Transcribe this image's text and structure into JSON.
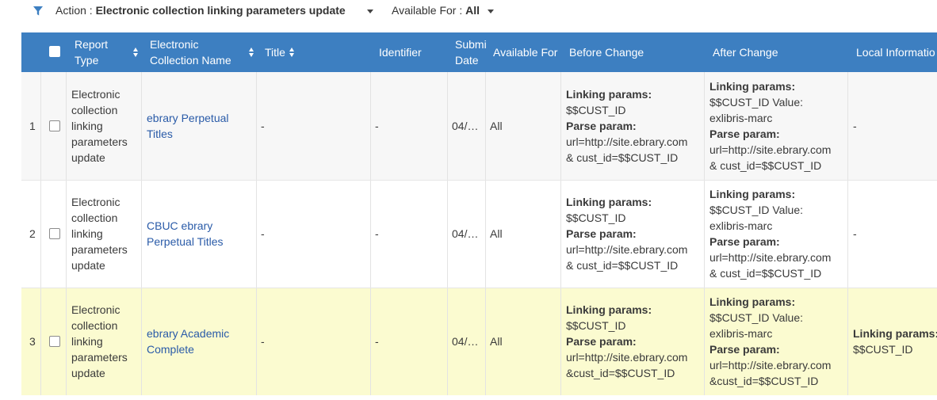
{
  "filter_bar": {
    "action_label": "Action :",
    "action_value": "Electronic collection linking parameters update",
    "available_label": "Available For :",
    "available_value": "All"
  },
  "table": {
    "headers": {
      "report_type_1": "Report",
      "report_type_2": "Type",
      "collection_1": "Electronic",
      "collection_2": "Collection Name",
      "title": "Title",
      "identifier": "Identifier",
      "submit_1": "Submi",
      "submit_2": "Date",
      "available_for": "Available For",
      "before": "Before Change",
      "after": "After Change",
      "local": "Local Informatio"
    },
    "rows": [
      {
        "num": "1",
        "type": [
          "Electronic",
          "collection",
          "linking",
          "parameters",
          "update"
        ],
        "collection": [
          "ebrary Perpetual",
          "Titles"
        ],
        "title": "-",
        "identifier": "-",
        "date": "04/…",
        "available": "All",
        "before": {
          "l1": "Linking params:",
          "l2": "$$CUST_ID",
          "l3": "Parse param:",
          "l4": "url=http://site.ebrary.com",
          "l5": "& cust_id=$$CUST_ID"
        },
        "after": {
          "l1": "Linking params:",
          "l2": "$$CUST_ID Value:",
          "l3": "exlibris-marc",
          "l4": "Parse param:",
          "l5": "url=http://site.ebrary.com",
          "l6": "& cust_id=$$CUST_ID"
        },
        "local": {
          "l1": "-",
          "l2": ""
        }
      },
      {
        "num": "2",
        "type": [
          "Electronic",
          "collection",
          "linking",
          "parameters",
          "update"
        ],
        "collection": [
          "CBUC ebrary",
          "Perpetual Titles"
        ],
        "title": "-",
        "identifier": "-",
        "date": "04/…",
        "available": "All",
        "before": {
          "l1": "Linking params:",
          "l2": "$$CUST_ID",
          "l3": "Parse param:",
          "l4": "url=http://site.ebrary.com",
          "l5": "& cust_id=$$CUST_ID"
        },
        "after": {
          "l1": "Linking params:",
          "l2": "$$CUST_ID Value:",
          "l3": "exlibris-marc",
          "l4": "Parse param:",
          "l5": "url=http://site.ebrary.com",
          "l6": "& cust_id=$$CUST_ID"
        },
        "local": {
          "l1": "-",
          "l2": ""
        }
      },
      {
        "num": "3",
        "type": [
          "Electronic",
          "collection",
          "linking",
          "parameters",
          "update"
        ],
        "collection": [
          "ebrary Academic",
          "Complete"
        ],
        "title": "-",
        "identifier": "-",
        "date": "04/…",
        "available": "All",
        "before": {
          "l1": "Linking params:",
          "l2": "$$CUST_ID",
          "l3": "Parse param:",
          "l4": "url=http://site.ebrary.com",
          "l5": "&cust_id=$$CUST_ID"
        },
        "after": {
          "l1": "Linking params:",
          "l2": "$$CUST_ID Value:",
          "l3": "exlibris-marc",
          "l4": "Parse param:",
          "l5": "url=http://site.ebrary.com",
          "l6": "&cust_id=$$CUST_ID"
        },
        "local": {
          "l1": "Linking params:",
          "l2": "$$CUST_ID"
        }
      }
    ]
  },
  "colors": {
    "header_bg": "#3d7fc1",
    "link": "#2a5ba8",
    "highlight_row": "#fbfbd0"
  },
  "icons": [
    "filter-funnel-icon",
    "chevron-down-icon",
    "sort-icon",
    "checkbox-icon"
  ]
}
